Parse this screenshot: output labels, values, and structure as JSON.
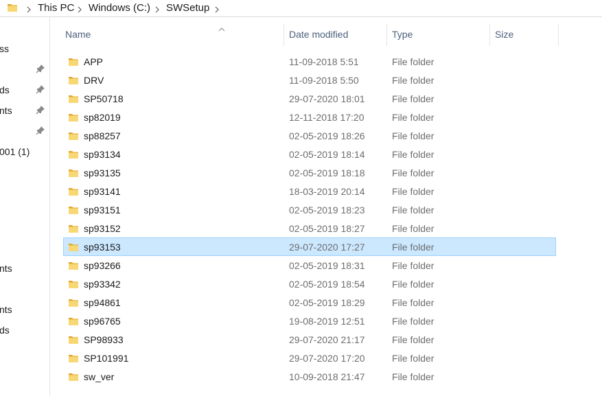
{
  "breadcrumb": {
    "folder_icon": "folder-icon",
    "items": [
      "This PC",
      "Windows (C:)",
      "SWSetup"
    ]
  },
  "nav_pane": {
    "items": [
      {
        "label": "ss",
        "pinned": false
      },
      {
        "label": "",
        "pinned": true
      },
      {
        "label": "ds",
        "pinned": true
      },
      {
        "label": "nts",
        "pinned": true
      },
      {
        "label": "",
        "pinned": true
      },
      {
        "label": "001 (1)",
        "pinned": false
      },
      {
        "label": "nts",
        "pinned": false
      },
      {
        "label": "nts",
        "pinned": false
      },
      {
        "label": "ds",
        "pinned": false
      }
    ]
  },
  "columns": {
    "name": "Name",
    "date": "Date modified",
    "type": "Type",
    "size": "Size",
    "sorted_by": "name",
    "sort_direction": "ascending"
  },
  "files": [
    {
      "name": "APP",
      "date": "11-09-2018 5:51",
      "type": "File folder",
      "size": ""
    },
    {
      "name": "DRV",
      "date": "11-09-2018 5:50",
      "type": "File folder",
      "size": ""
    },
    {
      "name": "SP50718",
      "date": "29-07-2020 18:01",
      "type": "File folder",
      "size": ""
    },
    {
      "name": "sp82019",
      "date": "12-11-2018 17:20",
      "type": "File folder",
      "size": ""
    },
    {
      "name": "sp88257",
      "date": "02-05-2019 18:26",
      "type": "File folder",
      "size": ""
    },
    {
      "name": "sp93134",
      "date": "02-05-2019 18:14",
      "type": "File folder",
      "size": ""
    },
    {
      "name": "sp93135",
      "date": "02-05-2019 18:18",
      "type": "File folder",
      "size": ""
    },
    {
      "name": "sp93141",
      "date": "18-03-2019 20:14",
      "type": "File folder",
      "size": ""
    },
    {
      "name": "sp93151",
      "date": "02-05-2019 18:23",
      "type": "File folder",
      "size": ""
    },
    {
      "name": "sp93152",
      "date": "02-05-2019 18:27",
      "type": "File folder",
      "size": ""
    },
    {
      "name": "sp93153",
      "date": "29-07-2020 17:27",
      "type": "File folder",
      "size": "",
      "selected": true
    },
    {
      "name": "sp93266",
      "date": "02-05-2019 18:31",
      "type": "File folder",
      "size": ""
    },
    {
      "name": "sp93342",
      "date": "02-05-2019 18:54",
      "type": "File folder",
      "size": ""
    },
    {
      "name": "sp94861",
      "date": "02-05-2019 18:29",
      "type": "File folder",
      "size": ""
    },
    {
      "name": "sp96765",
      "date": "19-08-2019 12:51",
      "type": "File folder",
      "size": ""
    },
    {
      "name": "SP98933",
      "date": "29-07-2020 21:17",
      "type": "File folder",
      "size": ""
    },
    {
      "name": "SP101991",
      "date": "29-07-2020 17:20",
      "type": "File folder",
      "size": ""
    },
    {
      "name": "sw_ver",
      "date": "10-09-2018 21:47",
      "type": "File folder",
      "size": ""
    }
  ],
  "colors": {
    "selection_bg": "#cce8ff",
    "selection_border": "#99d1ff",
    "folder_yellow": "#f8d775",
    "folder_dark": "#e0a82e",
    "header_text": "#4c607a",
    "secondary_text": "#6d6d6d"
  }
}
